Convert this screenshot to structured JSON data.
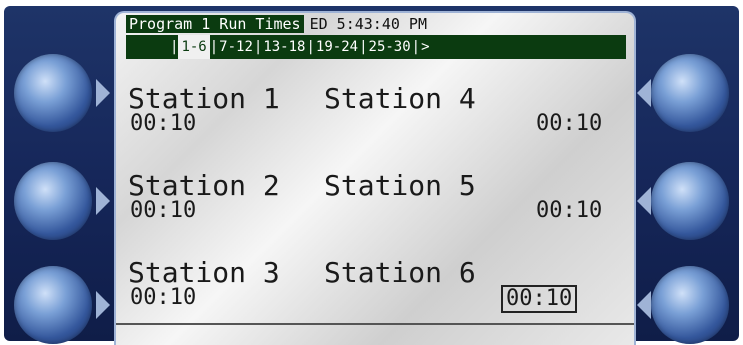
{
  "header": {
    "title": "Program 1 Run Times",
    "clock": "ED 5:43:40 PM"
  },
  "tabs": [
    {
      "label": "1-6",
      "active": true
    },
    {
      "label": "7-12",
      "active": false
    },
    {
      "label": "13-18",
      "active": false
    },
    {
      "label": "19-24",
      "active": false
    },
    {
      "label": "25-30",
      "active": false
    },
    {
      "label": ">",
      "active": false
    }
  ],
  "stations": {
    "left": [
      {
        "name": "Station 1",
        "time": "00:10"
      },
      {
        "name": "Station 2",
        "time": "00:10"
      },
      {
        "name": "Station 3",
        "time": "00:10"
      }
    ],
    "right": [
      {
        "name": "Station 4",
        "time": "00:10"
      },
      {
        "name": "Station 5",
        "time": "00:10"
      },
      {
        "name": "Station 6",
        "time": "00:10"
      }
    ]
  },
  "softkeys": {
    "left": [
      "softkey-left-1",
      "softkey-left-2",
      "softkey-left-3"
    ],
    "right": [
      "softkey-right-1",
      "softkey-right-2",
      "softkey-right-3"
    ]
  },
  "colors": {
    "panel": "#16275a",
    "display_header": "#0b3b10",
    "softkey": "#7aa0d6"
  }
}
